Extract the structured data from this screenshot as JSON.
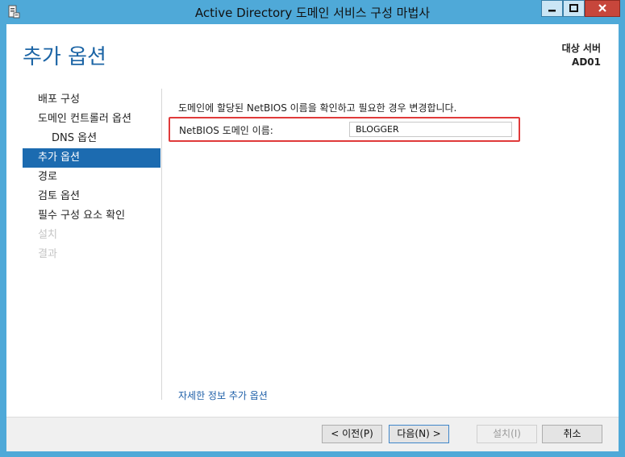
{
  "window": {
    "title": "Active Directory 도메인 서비스 구성 마법사"
  },
  "page": {
    "title": "추가 옵션",
    "target_label": "대상 서버",
    "target_server": "AD01"
  },
  "nav": {
    "items": [
      {
        "label": "배포 구성",
        "state": "normal"
      },
      {
        "label": "도메인 컨트롤러 옵션",
        "state": "normal"
      },
      {
        "label": "DNS 옵션",
        "state": "sub"
      },
      {
        "label": "추가 옵션",
        "state": "active"
      },
      {
        "label": "경로",
        "state": "normal"
      },
      {
        "label": "검토 옵션",
        "state": "normal"
      },
      {
        "label": "필수 구성 요소 확인",
        "state": "normal"
      },
      {
        "label": "설치",
        "state": "disabled"
      },
      {
        "label": "결과",
        "state": "disabled"
      }
    ]
  },
  "content": {
    "description": "도메인에 할당된 NetBIOS 이름을 확인하고 필요한 경우 변경합니다.",
    "netbios_label": "NetBIOS 도메인 이름:",
    "netbios_value": "BLOGGER",
    "more_link": "자세한 정보 추가 옵션"
  },
  "footer": {
    "prev": "< 이전(P)",
    "next": "다음(N) >",
    "install": "설치(I)",
    "cancel": "취소"
  },
  "colors": {
    "frame": "#4fa9d8",
    "accent": "#1c6bb0",
    "highlight_border": "#e03a3a",
    "close_button": "#c7463b"
  },
  "icons": {
    "app": "server-manager-icon",
    "minimize": "minimize-icon",
    "maximize": "maximize-icon",
    "close": "close-icon"
  }
}
